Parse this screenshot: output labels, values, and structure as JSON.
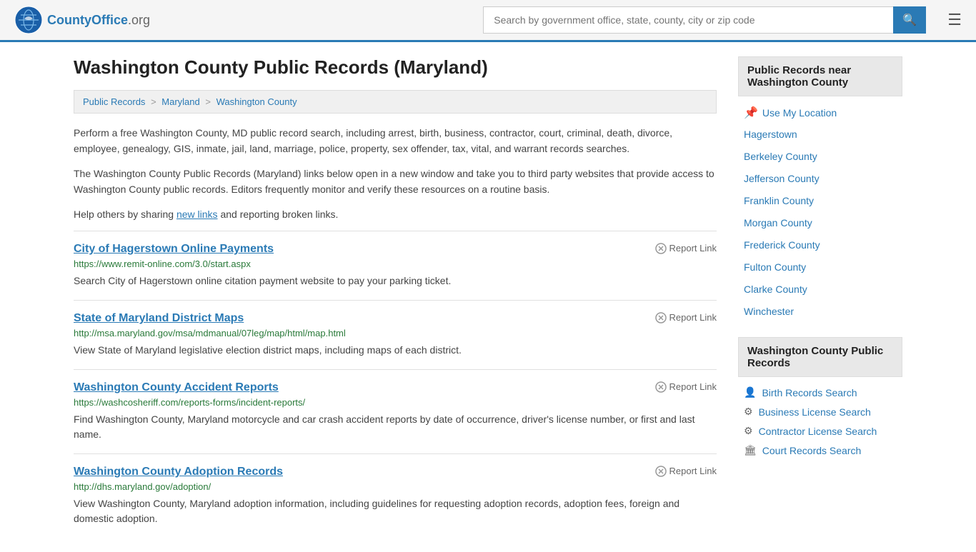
{
  "header": {
    "logo_text": "CountyOffice",
    "logo_suffix": ".org",
    "search_placeholder": "Search by government office, state, county, city or zip code",
    "search_value": ""
  },
  "page": {
    "title": "Washington County Public Records (Maryland)",
    "breadcrumb": [
      {
        "label": "Public Records",
        "href": "#"
      },
      {
        "label": "Maryland",
        "href": "#"
      },
      {
        "label": "Washington County",
        "href": "#"
      }
    ],
    "description1": "Perform a free Washington County, MD public record search, including arrest, birth, business, contractor, court, criminal, death, divorce, employee, genealogy, GIS, inmate, jail, land, marriage, police, property, sex offender, tax, vital, and warrant records searches.",
    "description2": "The Washington County Public Records (Maryland) links below open in a new window and take you to third party websites that provide access to Washington County public records. Editors frequently monitor and verify these resources on a routine basis.",
    "description3_prefix": "Help others by sharing ",
    "description3_link": "new links",
    "description3_suffix": " and reporting broken links."
  },
  "records": [
    {
      "title": "City of Hagerstown Online Payments",
      "url": "https://www.remit-online.com/3.0/start.aspx",
      "description": "Search City of Hagerstown online citation payment website to pay your parking ticket.",
      "report_label": "Report Link"
    },
    {
      "title": "State of Maryland District Maps",
      "url": "http://msa.maryland.gov/msa/mdmanual/07leg/map/html/map.html",
      "description": "View State of Maryland legislative election district maps, including maps of each district.",
      "report_label": "Report Link"
    },
    {
      "title": "Washington County Accident Reports",
      "url": "https://washcosheriff.com/reports-forms/incident-reports/",
      "description": "Find Washington County, Maryland motorcycle and car crash accident reports by date of occurrence, driver's license number, or first and last name.",
      "report_label": "Report Link"
    },
    {
      "title": "Washington County Adoption Records",
      "url": "http://dhs.maryland.gov/adoption/",
      "description": "View Washington County, Maryland adoption information, including guidelines for requesting adoption records, adoption fees, foreign and domestic adoption.",
      "report_label": "Report Link"
    }
  ],
  "sidebar": {
    "nearby_header": "Public Records near Washington County",
    "use_my_location": "Use My Location",
    "nearby_places": [
      "Hagerstown",
      "Berkeley County",
      "Jefferson County",
      "Franklin County",
      "Morgan County",
      "Frederick County",
      "Fulton County",
      "Clarke County",
      "Winchester"
    ],
    "records_header": "Washington County Public Records",
    "record_links": [
      {
        "label": "Birth Records Search",
        "icon": "person"
      },
      {
        "label": "Business License Search",
        "icon": "gear"
      },
      {
        "label": "Contractor License Search",
        "icon": "gear"
      },
      {
        "label": "Court Records Search",
        "icon": "building"
      }
    ]
  }
}
